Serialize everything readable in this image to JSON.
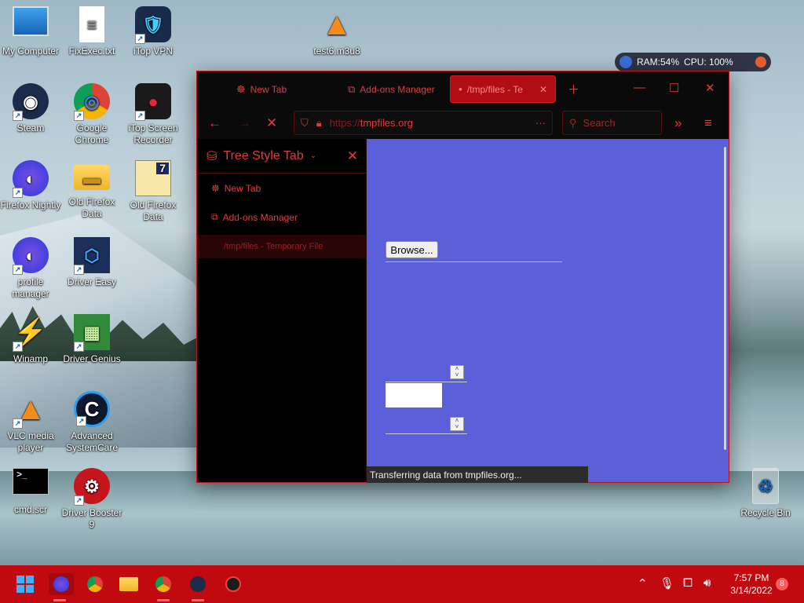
{
  "desktop": {
    "icons": [
      {
        "label": "My Computer",
        "glyph": "▭"
      },
      {
        "label": "FixExec.txt",
        "glyph": "≡"
      },
      {
        "label": "iTop VPN",
        "glyph": "🛡"
      },
      {
        "label": "test6.m3u8",
        "glyph": "▲"
      },
      {
        "label": "Steam",
        "glyph": "◉"
      },
      {
        "label": "Google Chrome",
        "glyph": "◎"
      },
      {
        "label": "iTop Screen Recorder",
        "glyph": "●"
      },
      {
        "label": "Firefox Nightly",
        "glyph": "◐"
      },
      {
        "label": "Old Firefox Data",
        "glyph": "▬"
      },
      {
        "label": "Old Firefox Data",
        "glyph": "7"
      },
      {
        "label": "profile manager",
        "glyph": "◐"
      },
      {
        "label": "Driver Easy",
        "glyph": "⬡"
      },
      {
        "label": "Winamp",
        "glyph": "⚡"
      },
      {
        "label": "Driver Genius",
        "glyph": "▦"
      },
      {
        "label": "VLC media player",
        "glyph": "▲"
      },
      {
        "label": "Advanced SystemCare",
        "glyph": "C"
      },
      {
        "label": "cmd.scr",
        "glyph": ">_"
      },
      {
        "label": "Driver Booster 9",
        "glyph": "⚙"
      },
      {
        "label": "Recycle Bin",
        "glyph": "♲"
      }
    ]
  },
  "perf_widget": {
    "ram": "RAM:54%",
    "cpu": "CPU: 100%"
  },
  "browser": {
    "tabs": [
      {
        "label": "New Tab",
        "icon": "new-tab-icon"
      },
      {
        "label": "Add-ons Manager",
        "icon": "puzzle-icon"
      },
      {
        "label": "/tmp/files - Te",
        "icon": "loading-dot-icon"
      }
    ],
    "url": {
      "prefix": "https://",
      "host": "tmpfiles.org"
    },
    "search_placeholder": "Search",
    "sidebar": {
      "title": "Tree Style Tab",
      "items": [
        {
          "label": "New Tab"
        },
        {
          "label": "Add-ons Manager"
        },
        {
          "label": "/tmp/files - Temporary File"
        }
      ]
    },
    "content": {
      "browse_label": "Browse...",
      "status": "Transferring data from tmpfiles.org..."
    }
  },
  "taskbar": {
    "time": "7:57 PM",
    "date": "3/14/2022",
    "notifications": "8"
  },
  "colors": {
    "accent": "#e23b3b",
    "taskbar": "#c00a0f",
    "content_bg": "#5b5fd9"
  }
}
